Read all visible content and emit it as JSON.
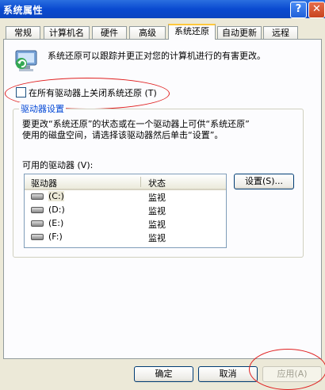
{
  "window": {
    "title": "系统属性",
    "help_glyph": "?",
    "close_glyph": "✕"
  },
  "tabs": [
    {
      "label": "常规"
    },
    {
      "label": "计算机名"
    },
    {
      "label": "硬件"
    },
    {
      "label": "高级"
    },
    {
      "label": "系统还原",
      "active": true
    },
    {
      "label": "自动更新"
    },
    {
      "label": "远程"
    }
  ],
  "intro_text": "系统还原可以跟踪并更正对您的计算机进行的有害更改。",
  "turn_off_checkbox": {
    "label": "在所有驱动器上关闭系统还原 (T)",
    "checked": false
  },
  "drive_settings": {
    "group_label": "驱动器设置",
    "description_line1": "要更改“系统还原”的状态或在一个驱动器上可供“系统还原”",
    "description_line2": "使用的磁盘空间，请选择该驱动器然后单击“设置”。",
    "available_label": "可用的驱动器 (V):",
    "columns": {
      "drive": "驱动器",
      "status": "状态"
    },
    "drives": [
      {
        "name": "(C:)",
        "status": "监视"
      },
      {
        "name": "(D:)",
        "status": "监视"
      },
      {
        "name": "(E:)",
        "status": "监视"
      },
      {
        "name": "(F:)",
        "status": "监视"
      }
    ],
    "settings_button": "设置(S)..."
  },
  "footer": {
    "ok": "确定",
    "cancel": "取消",
    "apply": "应用(A)"
  },
  "colors": {
    "annotation": "#E02020",
    "titlebar": "#0A4AD0",
    "group_label": "#0046D5"
  }
}
